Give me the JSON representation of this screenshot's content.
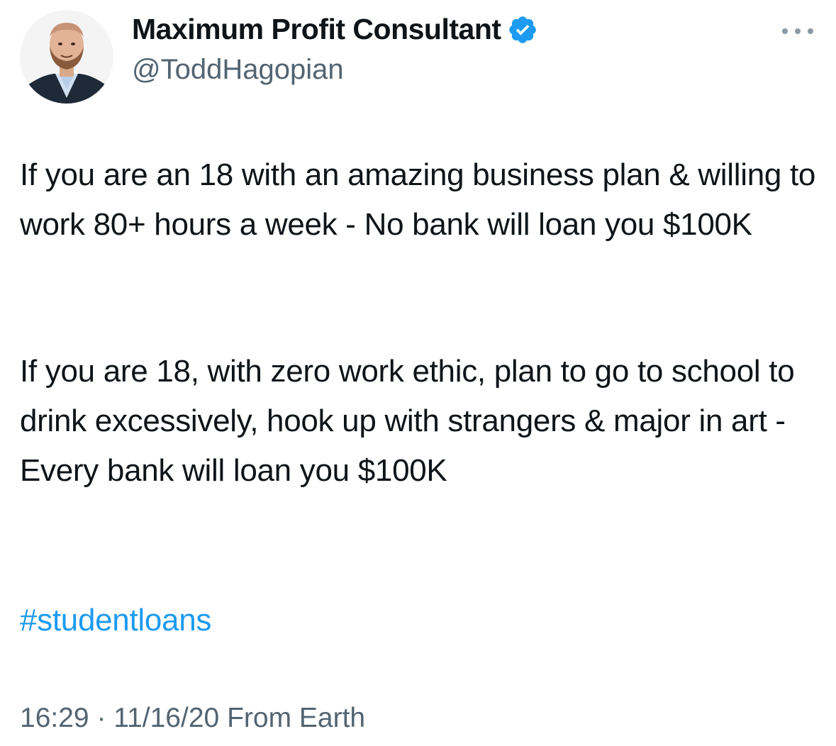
{
  "author": {
    "display_name": "Maximum Profit Consultant",
    "handle": "@ToddHagopian",
    "verified": true,
    "avatar_icon": "profile-photo"
  },
  "tweet": {
    "paragraph_1": "If you are an 18 with an amazing business plan & willing to work 80+ hours a week - No bank will loan you $100K",
    "paragraph_2": "If you are 18, with zero work ethic, plan to go to school to drink excessively, hook up with strangers & major in art - Every bank will loan you $100K",
    "hashtag": "#studentloans"
  },
  "meta": {
    "time": "16:29",
    "separator": "·",
    "date": "11/16/20",
    "source": "From Earth"
  },
  "icons": {
    "verified": "verified-badge-icon",
    "more": "more-options-icon"
  },
  "colors": {
    "link": "#1d9bf0",
    "verified": "#1d9bf0",
    "secondary_text": "#536471",
    "primary_text": "#0f1419"
  }
}
